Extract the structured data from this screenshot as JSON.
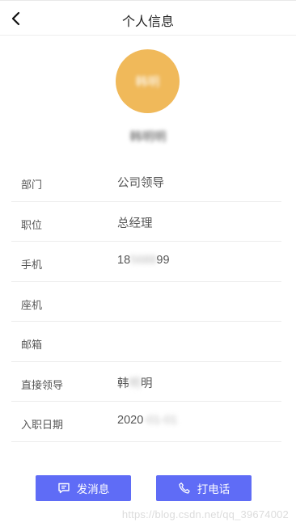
{
  "header": {
    "title": "个人信息",
    "back_icon": "chevron-left-icon"
  },
  "profile": {
    "avatar_text": "韩明",
    "name": "韩明明"
  },
  "fields": [
    {
      "label": "部门",
      "value": "公司领导",
      "value_hidden": ""
    },
    {
      "label": "职位",
      "value": "总经理",
      "value_hidden": ""
    },
    {
      "label": "手机",
      "value": "18",
      "value_hidden": "5688",
      "value_suffix": "99"
    },
    {
      "label": "座机",
      "value": ""
    },
    {
      "label": "邮箱",
      "value": ""
    },
    {
      "label": "直接领导",
      "value": "韩",
      "value_hidden": "明",
      "value_suffix": "明"
    },
    {
      "label": "入职日期",
      "value": "2020",
      "value_hidden": "-01-01"
    }
  ],
  "actions": {
    "message": {
      "label": "发消息",
      "icon": "message-icon"
    },
    "call": {
      "label": "打电话",
      "icon": "phone-icon"
    }
  },
  "watermark": "https://blog.csdn.net/qq_39674002",
  "colors": {
    "accent": "#5f6cf6",
    "avatar_bg": "#f0b95a"
  }
}
